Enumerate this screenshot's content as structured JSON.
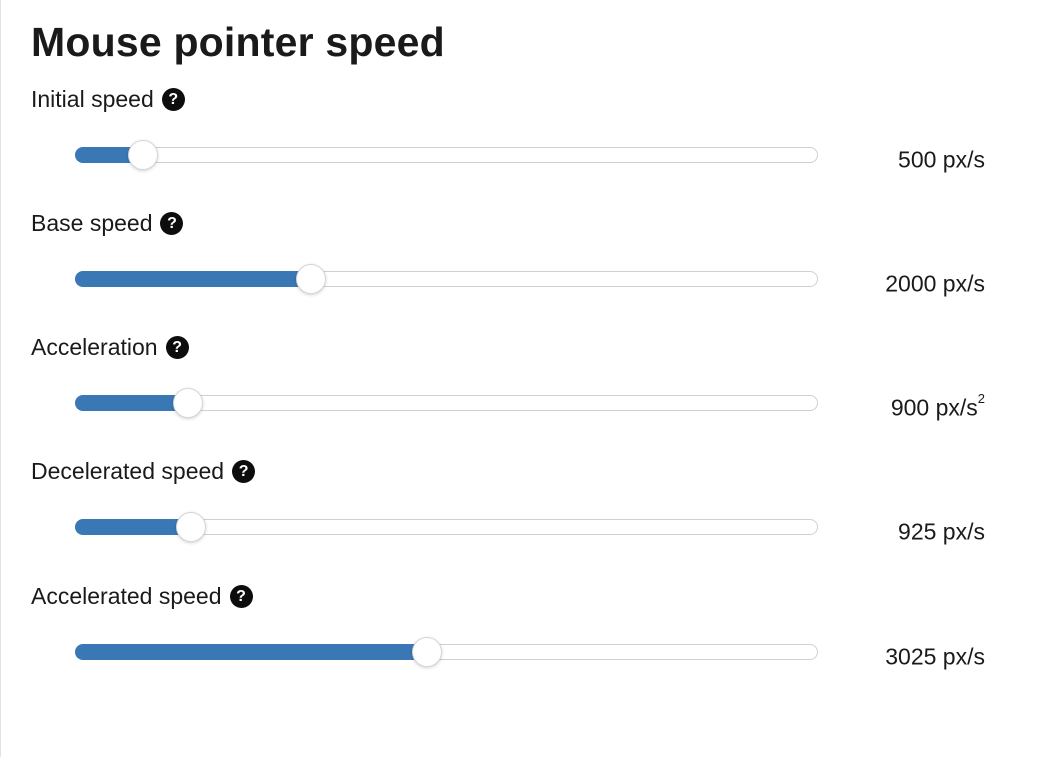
{
  "title": "Mouse pointer speed",
  "colors": {
    "accent": "#3a78b5",
    "help_icon": "#0d0d0d",
    "track_border": "#d0d0d0"
  },
  "help_icon_glyph": "?",
  "settings": [
    {
      "label": "Initial speed",
      "value_text": "500 px/s",
      "unit_superscript": "",
      "fraction": 0.075
    },
    {
      "label": "Base speed",
      "value_text": "2000 px/s",
      "unit_superscript": "",
      "fraction": 0.31
    },
    {
      "label": "Acceleration",
      "value_text": "900 px/s",
      "unit_superscript": "2",
      "fraction": 0.138
    },
    {
      "label": "Decelerated speed",
      "value_text": "925 px/s",
      "unit_superscript": "",
      "fraction": 0.141
    },
    {
      "label": "Accelerated speed",
      "value_text": "3025 px/s",
      "unit_superscript": "",
      "fraction": 0.473
    }
  ]
}
